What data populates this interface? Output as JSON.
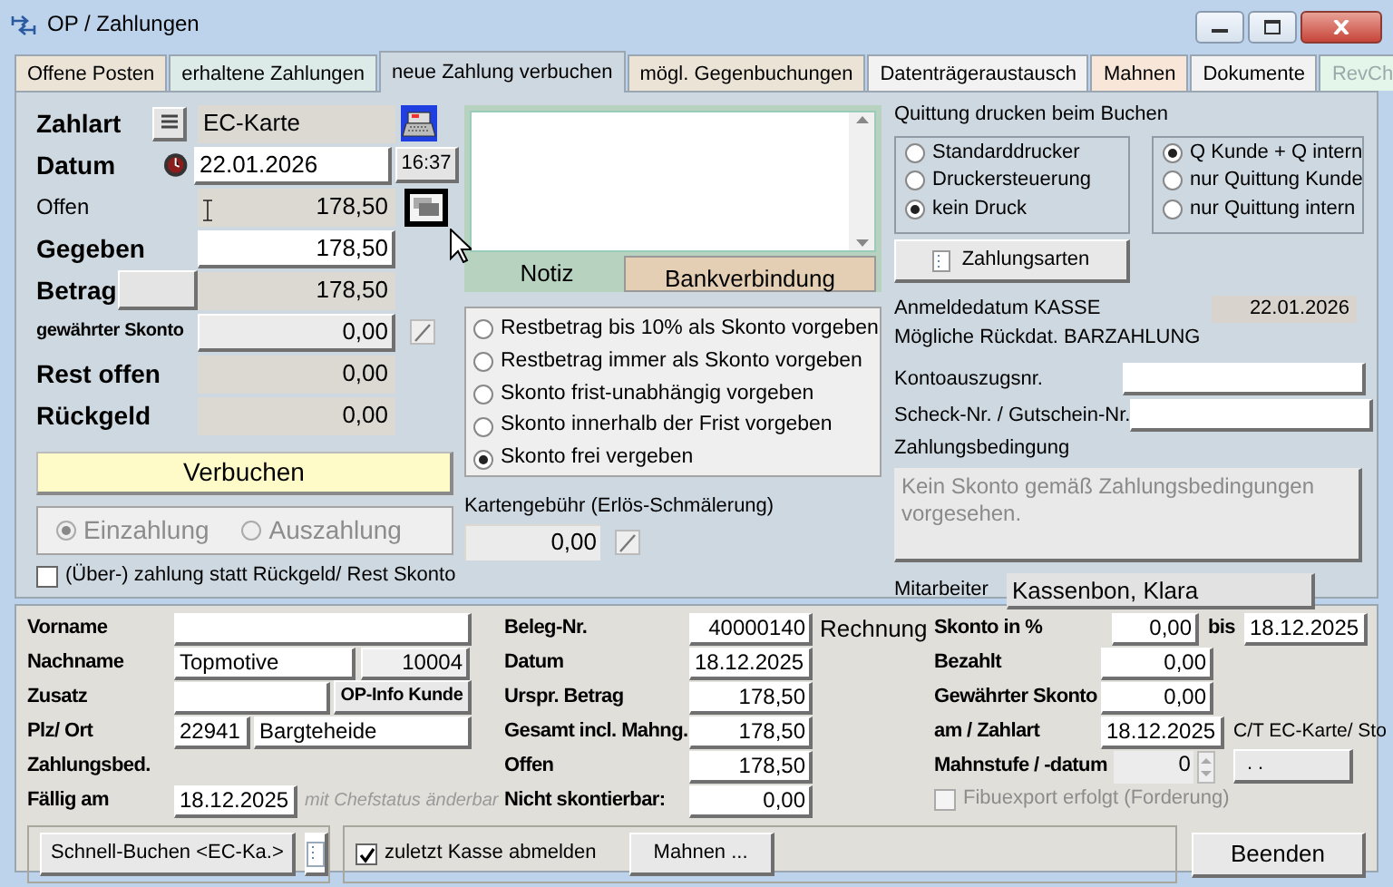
{
  "window": {
    "title": "OP / Zahlungen"
  },
  "tabs": [
    {
      "label": "Offene Posten",
      "selected": false,
      "disabled": false,
      "color": "#ebe4d6"
    },
    {
      "label": "erhaltene Zahlungen",
      "selected": false,
      "disabled": false,
      "color": "#dcebe8"
    },
    {
      "label": "neue Zahlung verbuchen",
      "selected": true,
      "disabled": false,
      "color": "#cdd8e0"
    },
    {
      "label": "mögl. Gegenbuchungen",
      "selected": false,
      "disabled": false,
      "color": "#ebe4d6"
    },
    {
      "label": "Datenträgeraustausch",
      "selected": false,
      "disabled": false,
      "color": "#f2f2f2"
    },
    {
      "label": "Mahnen",
      "selected": false,
      "disabled": false,
      "color": "#f8e7d8"
    },
    {
      "label": "Dokumente",
      "selected": false,
      "disabled": false,
      "color": "#f2f2f2"
    },
    {
      "label": "RevCh",
      "selected": false,
      "disabled": true,
      "color": "#e4f6ea"
    }
  ],
  "payment": {
    "rows": [
      {
        "kind": "method",
        "label": "Zahlart",
        "value": "EC-Karte"
      },
      {
        "kind": "date",
        "label": "Datum",
        "value": "22.01.2026",
        "button": "16:37"
      },
      {
        "kind": "open",
        "label": "Offen",
        "value": "178,50"
      },
      {
        "kind": "given",
        "label": "Gegeben",
        "value": "178,50"
      },
      {
        "kind": "amount",
        "label": "Betrag",
        "value": "178,50"
      },
      {
        "kind": "discount",
        "label": "gewährter Skonto",
        "value": "0,00"
      },
      {
        "kind": "plain",
        "label": "Rest offen",
        "value": "0,00"
      },
      {
        "kind": "plain",
        "label": "Rückgeld",
        "value": "0,00"
      }
    ],
    "book_button": "Verbuchen",
    "direction": [
      {
        "label": "Einzahlung",
        "selected": true,
        "disabled": true
      },
      {
        "label": "Auszahlung",
        "selected": false,
        "disabled": true
      }
    ],
    "overpay": {
      "label": "(Über-) zahlung statt Rückgeld/ Rest Skonto",
      "checked": false
    }
  },
  "note": {
    "tabs": [
      {
        "label": "Notiz",
        "selected": true
      },
      {
        "label": "Bankverbindung",
        "selected": false
      }
    ]
  },
  "discount_options": [
    {
      "label": "Restbetrag bis 10% als Skonto vorgeben",
      "selected": false
    },
    {
      "label": "Restbetrag immer als Skonto vorgeben",
      "selected": false
    },
    {
      "label": "Skonto frist-unabhängig vorgeben",
      "selected": false
    },
    {
      "label": "Skonto innerhalb der Frist vorgeben",
      "selected": false
    },
    {
      "label": "Skonto frei vergeben",
      "selected": true
    }
  ],
  "card_fee": {
    "label": "Kartengebühr (Erlös-Schmälerung)",
    "value": "0,00"
  },
  "receipt": {
    "title": "Quittung drucken beim Buchen",
    "printer": [
      {
        "label": "Standarddrucker",
        "selected": false
      },
      {
        "label": "Druckersteuerung",
        "selected": false
      },
      {
        "label": "kein Druck",
        "selected": true
      }
    ],
    "copies": [
      {
        "label": "Q Kunde + Q intern",
        "selected": true
      },
      {
        "label": "nur Quittung Kunde",
        "selected": false
      },
      {
        "label": "nur Quittung intern",
        "selected": false
      }
    ],
    "button": "Zahlungsarten"
  },
  "login_date": {
    "label": "Anmeldedatum KASSE",
    "value": "22.01.2026"
  },
  "backdate_note": "Mögliche Rückdat. BARZAHLUNG",
  "reference_fields": [
    {
      "label": "Kontoauszugsnr."
    },
    {
      "label": "Scheck-Nr. / Gutschein-Nr."
    }
  ],
  "terms": {
    "label": "Zahlungsbedingung",
    "text": "Kein Skonto gemäß Zahlungsbedingungen vorgesehen."
  },
  "staff": {
    "label": "Mitarbeiter",
    "value": "Kassenbon, Klara"
  },
  "customer": [
    {
      "kind": "text",
      "label": "Vorname"
    },
    {
      "kind": "name",
      "label": "Nachname",
      "value": "Topmotive",
      "number": "10004"
    },
    {
      "kind": "extra",
      "label": "Zusatz",
      "button": "OP-Info Kunde"
    },
    {
      "kind": "city",
      "label": "Plz/ Ort",
      "zip": "22941",
      "city": "Bargteheide"
    },
    {
      "kind": "none",
      "label": "Zahlungsbed."
    },
    {
      "kind": "due",
      "label": "Fällig am",
      "value": "18.12.2025",
      "note": "mit Chefstatus änderbar"
    }
  ],
  "document": [
    {
      "kind": "number",
      "label": "Beleg-Nr.",
      "value": "40000140",
      "suffix": "Rechnung"
    },
    {
      "kind": "date",
      "label": "Datum",
      "value": "18.12.2025"
    },
    {
      "kind": "number",
      "label": "Urspr. Betrag",
      "value": "178,50"
    },
    {
      "kind": "number",
      "label": "Gesamt incl. Mahng.",
      "value": "178,50"
    },
    {
      "kind": "number",
      "label": "Offen",
      "value": "178,50"
    },
    {
      "kind": "number",
      "label": "Nicht skontierbar:",
      "value": "0,00"
    }
  ],
  "discount": [
    {
      "kind": "percent",
      "label": "Skonto in %",
      "value": "0,00",
      "until_label": "bis",
      "until": "18.12.2025"
    },
    {
      "kind": "number",
      "label": "Bezahlt",
      "value": "0,00"
    },
    {
      "kind": "number",
      "label": "Gewährter Skonto",
      "value": "0,00"
    },
    {
      "kind": "date",
      "label": "am / Zahlart",
      "value": "18.12.2025",
      "suffix": "C/T EC-Karte/ Sto"
    },
    {
      "kind": "dunning",
      "label": "Mahnstufe / -datum",
      "value": "0",
      "button": ". ."
    }
  ],
  "fibu_export": {
    "label": "Fibuexport erfolgt (Forderung)",
    "checked": false,
    "disabled": true
  },
  "footer": {
    "quick_book": "Schnell-Buchen <EC-Ka.>",
    "logout": {
      "label": "zuletzt Kasse abmelden",
      "checked": true
    },
    "dunning_button": "Mahnen ...",
    "close_button": "Beenden"
  }
}
